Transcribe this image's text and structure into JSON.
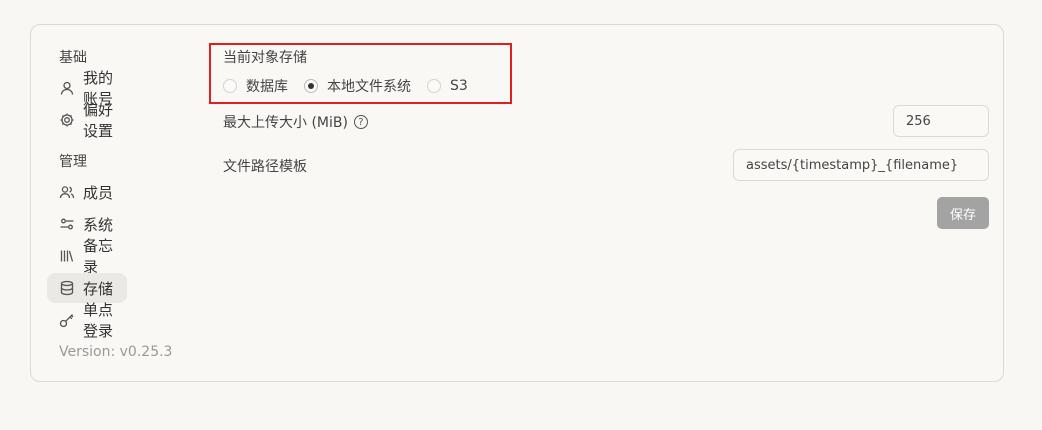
{
  "sidebar": {
    "section_basic": "基础",
    "section_manage": "管理",
    "items": [
      {
        "label": "我的账号",
        "icon": "user-icon"
      },
      {
        "label": "偏好设置",
        "icon": "gear-icon"
      },
      {
        "label": "成员",
        "icon": "users-icon"
      },
      {
        "label": "系统",
        "icon": "sliders-icon"
      },
      {
        "label": "备忘录",
        "icon": "library-icon"
      },
      {
        "label": "存储",
        "icon": "database-icon",
        "active": true
      },
      {
        "label": "单点登录",
        "icon": "key-icon"
      }
    ],
    "version": "Version: v0.25.3"
  },
  "storage": {
    "current_label": "当前对象存储",
    "options": [
      {
        "label": "数据库",
        "checked": false
      },
      {
        "label": "本地文件系统",
        "checked": true
      },
      {
        "label": "S3",
        "checked": false
      }
    ],
    "max_upload_label": "最大上传大小 (MiB)",
    "max_upload_value": "256",
    "path_template_label": "文件路径模板",
    "path_template_value": "assets/{timestamp}_{filename}",
    "save_label": "保存"
  },
  "colors": {
    "highlight": "#e02020",
    "save_button_bg": "#a3a3a3",
    "active_item_bg": "#ebe9e3"
  }
}
